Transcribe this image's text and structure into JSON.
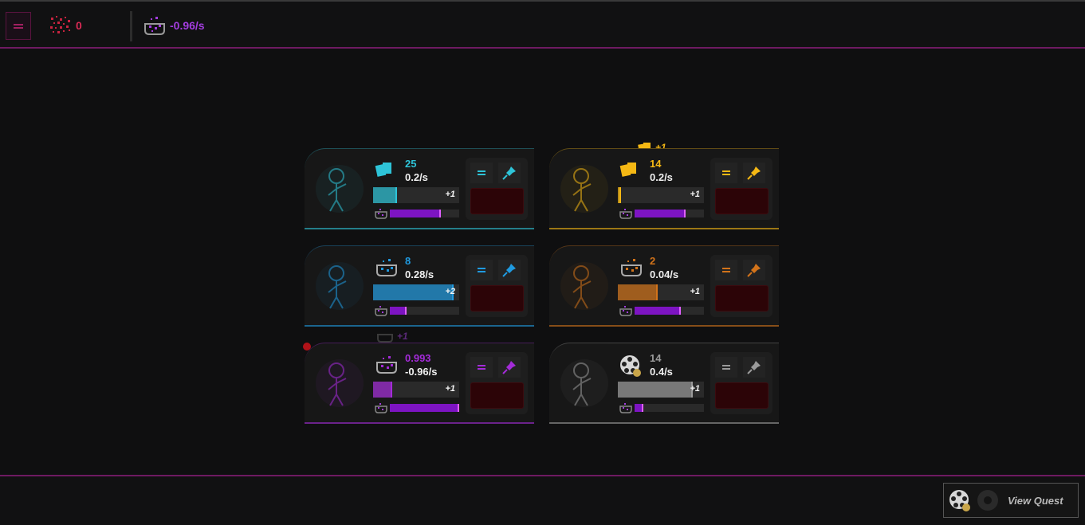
{
  "topbar": {
    "resource1": {
      "icon": "red-particles-icon",
      "value": "0",
      "color": "#d92a55"
    },
    "resource2": {
      "icon": "purple-cauldron-icon",
      "value": "-0.96/s",
      "color": "#a33ddf"
    }
  },
  "cards": [
    {
      "id": "paper",
      "color": "#2ec4d8",
      "count": "25",
      "rate": "0.2/s",
      "mult": "+1",
      "progress": 0.26,
      "sub_progress": 0.71,
      "icon": "cyan-cards-icon"
    },
    {
      "id": "gold",
      "color": "#f5b814",
      "count": "14",
      "rate": "0.2/s",
      "mult": "+1",
      "progress": 0.02,
      "sub_progress": 0.71,
      "icon": "gold-cards-icon"
    },
    {
      "id": "water",
      "color": "#1f9ae0",
      "count": "8",
      "rate": "0.28/s",
      "mult": "+2",
      "progress": 0.92,
      "sub_progress": 0.22,
      "icon": "blue-cauldron-icon"
    },
    {
      "id": "ore",
      "color": "#d2731a",
      "count": "2",
      "rate": "0.04/s",
      "mult": "+1",
      "progress": 0.44,
      "sub_progress": 0.64,
      "icon": "orange-ore-icon"
    },
    {
      "id": "magic",
      "color": "#a42bd9",
      "count": "0.993",
      "rate": "-0.96/s",
      "mult": "+1",
      "progress": 0.2,
      "sub_progress": 0.99,
      "icon": "purple-cauldron-icon"
    },
    {
      "id": "film",
      "color": "#9a9a9a",
      "count": "14",
      "rate": "0.4/s",
      "mult": "+1",
      "progress": 0.85,
      "sub_progress": 0.1,
      "icon": "film-reel-icon"
    }
  ],
  "floats": [
    {
      "text": "+1",
      "color": "#f5b814"
    },
    {
      "text": "+1",
      "color": "#5b2a7a"
    }
  ],
  "quest": {
    "label": "View Quest"
  }
}
